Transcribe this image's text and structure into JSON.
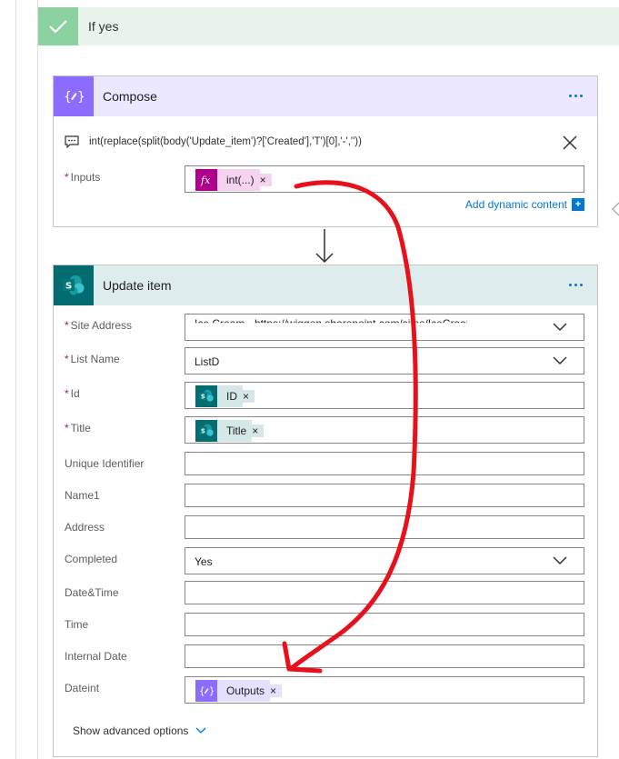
{
  "branch": {
    "title": "If yes"
  },
  "compose": {
    "title": "Compose",
    "expression": "int(replace(split(body('Update_item')?['Created'],'T')[0],'-',''))",
    "inputs_label": "Inputs",
    "inputs_token": "int(...)",
    "add_dynamic": "Add dynamic content"
  },
  "update_item": {
    "title": "Update item",
    "fields": {
      "site_address": {
        "label": "Site Address",
        "value": "Ice Cream - https://wiggen.sharepoint.com/sites/IceCream"
      },
      "list_name": {
        "label": "List Name",
        "value": "ListD"
      },
      "id": {
        "label": "Id",
        "token": "ID"
      },
      "title": {
        "label": "Title",
        "token": "Title"
      },
      "unique_identifier": {
        "label": "Unique Identifier",
        "value": ""
      },
      "name1": {
        "label": "Name1",
        "value": ""
      },
      "address": {
        "label": "Address",
        "value": ""
      },
      "completed": {
        "label": "Completed",
        "value": "Yes"
      },
      "date_time": {
        "label": "Date&Time",
        "value": ""
      },
      "time": {
        "label": "Time",
        "value": ""
      },
      "internal_date": {
        "label": "Internal Date",
        "value": ""
      },
      "dateint": {
        "label": "Dateint",
        "token": "Outputs"
      }
    },
    "show_advanced": "Show advanced options"
  },
  "token_close": "×",
  "colors": {
    "success": "#8cd2a0",
    "compose_accent": "#8c6cff",
    "sharepoint": "#036c70",
    "expression": "#ad008c",
    "link": "#0078d4",
    "annotation": "#e8101a"
  }
}
